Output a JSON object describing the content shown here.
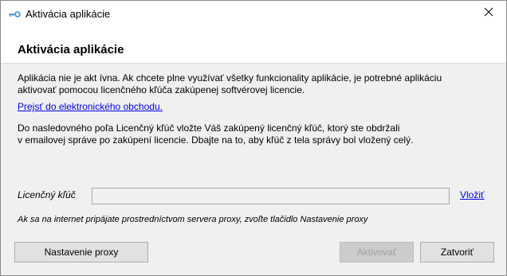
{
  "window": {
    "title": "Aktivácia aplikácie",
    "icon": "key-icon",
    "close_glyph": "✕"
  },
  "header": {
    "heading": "Aktivácia aplikácie"
  },
  "body": {
    "intro_line1": "Aplikácia nie je akt ívna. Ak chcete plne využívať všetky funkcionality aplikácie, je potrebné aplikáciu",
    "intro_line2": "aktivovať pomocou licenčného kľúča zakúpenej softvérovej licencie.",
    "store_link": "Prejsť do elektronického obchodu.",
    "instructions_line1": "Do nasledovného poľa Licenčný kľúč vložte Váš zakúpený licenčný kľúč, ktorý ste obdržali",
    "instructions_line2": "v emailovej správe po zakúpení licencie. Dbajte na to, aby kľúč z tela správy bol vložený celý."
  },
  "license": {
    "label": "Licenčný kľúč",
    "value": "",
    "paste_link": "Vložiť"
  },
  "proxy_note": "Ak sa na internet pripájate prostredníctvom servera proxy, zvoľte tlačidlo Nastavenie proxy",
  "buttons": {
    "proxy": "Nastavenie proxy",
    "activate": "Aktivovať",
    "close": "Zatvoriť"
  }
}
